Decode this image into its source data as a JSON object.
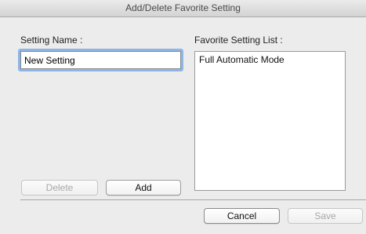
{
  "window": {
    "title": "Add/Delete Favorite Setting"
  },
  "setting_name": {
    "label": "Setting Name :",
    "value": "New Setting"
  },
  "favorite_list": {
    "label": "Favorite Setting List :",
    "items": [
      "Full Automatic Mode"
    ]
  },
  "buttons": {
    "delete": "Delete",
    "add": "Add",
    "cancel": "Cancel",
    "save": "Save"
  },
  "colors": {
    "focus_ring": "#8db5e6",
    "window_bg": "#ececec"
  }
}
